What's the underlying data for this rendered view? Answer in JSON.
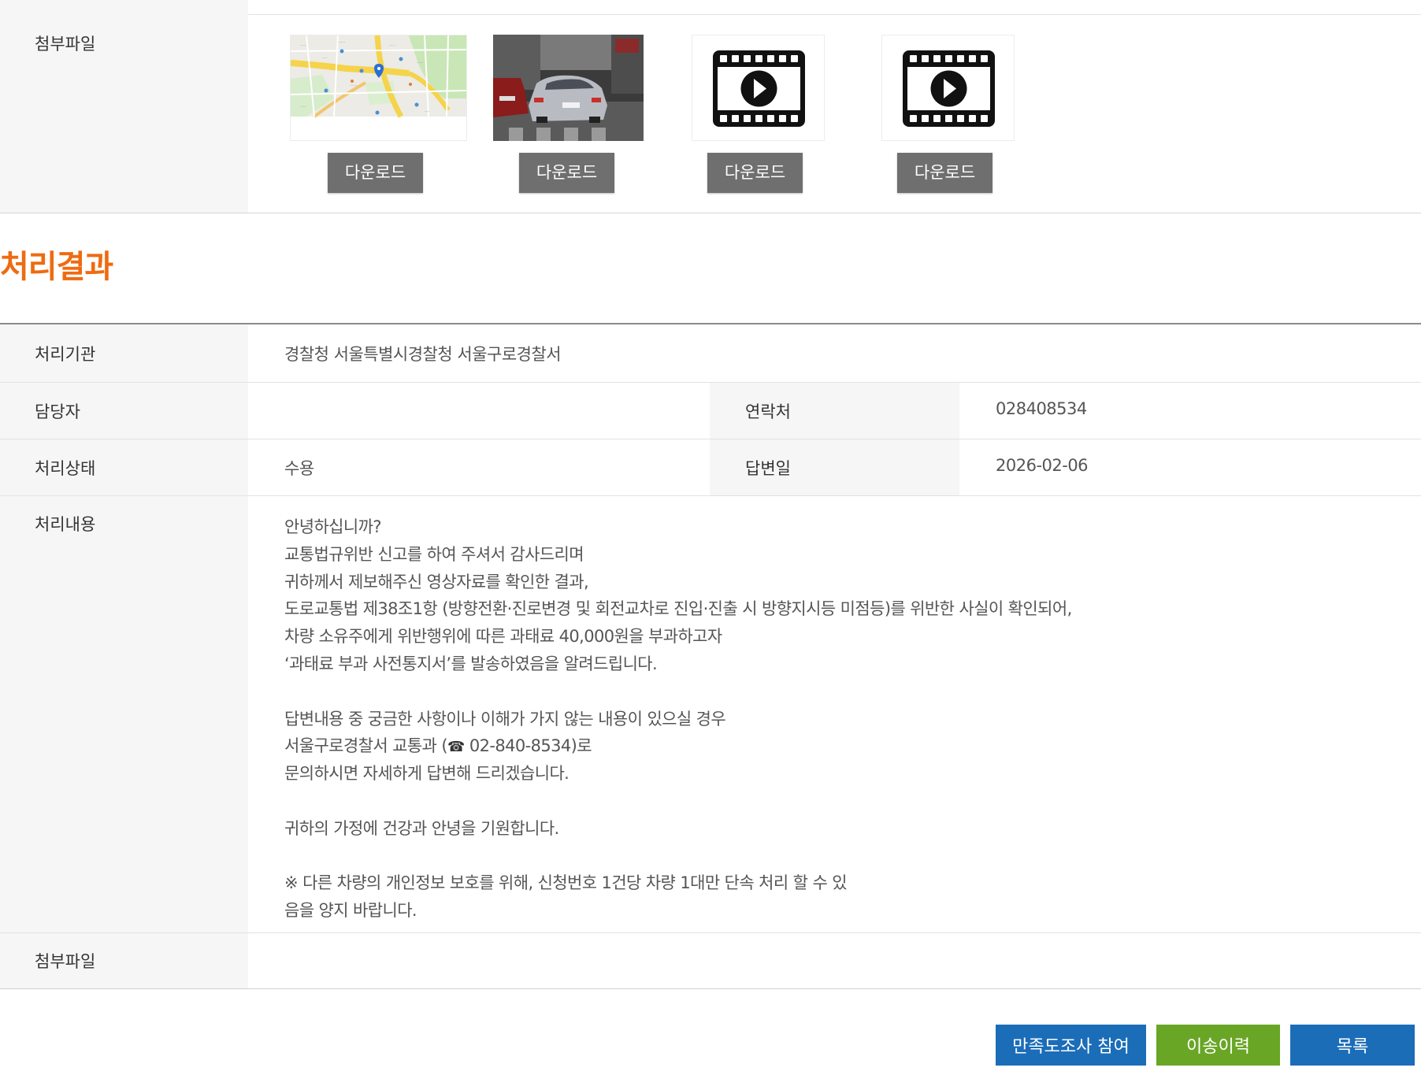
{
  "attachments_top": {
    "label": "첨부파일",
    "items": [
      {
        "type": "map-image",
        "download_label": "다운로드"
      },
      {
        "type": "photo",
        "download_label": "다운로드"
      },
      {
        "type": "video",
        "download_label": "다운로드"
      },
      {
        "type": "video",
        "download_label": "다운로드"
      }
    ]
  },
  "result": {
    "title": "처리결과",
    "org_label": "처리기관",
    "org_value": "경찰청 서울특별시경찰청 서울구로경찰서",
    "manager_label": "담당자",
    "manager_value": "",
    "contact_label": "연락처",
    "contact_value": "028408534",
    "status_label": "처리상태",
    "status_value": "수용",
    "answer_date_label": "답변일",
    "answer_date_value": "2026-02-06",
    "content_label": "처리내용",
    "content_lines": [
      "안녕하십니까?",
      "교통법규위반 신고를 하여 주셔서 감사드리며",
      "귀하께서 제보해주신 영상자료를 확인한 결과,",
      "도로교통법 제38조1항 (방향전환·진로변경 및 회전교차로 진입·진출 시 방향지시등 미점등)를 위반한 사실이 확인되어,",
      "차량 소유주에게 위반행위에 따른 과태료 40,000원을 부과하고자",
      "‘과태료 부과 사전통지서’를 발송하였음을 알려드립니다.",
      "",
      "답변내용 중 궁금한 사항이나 이해가 가지 않는 내용이 있으실 경우",
      "서울구로경찰서 교통과 (",
      "문의하시면 자세하게 답변해 드리겠습니다.",
      "",
      "귀하의 가정에 건강과 안녕을 기원합니다.",
      "",
      "※ 다른 차량의 개인정보 보호를 위해, 신청번호 1건당 차량 1대만 단속 처리 할 수 있",
      "음을 양지 바랍니다."
    ],
    "phone_line_suffix": " 02-840-8534)로",
    "attach_label": "첨부파일"
  },
  "buttons": {
    "survey": "만족도조사 참여",
    "transfer_history": "이송이력",
    "list": "목록"
  },
  "colors": {
    "accent_orange": "#ee6b11",
    "button_blue": "#1b6db8",
    "button_green": "#6aa626",
    "download_gray": "#6f6f6f"
  },
  "icons": {
    "phone": "☎"
  }
}
